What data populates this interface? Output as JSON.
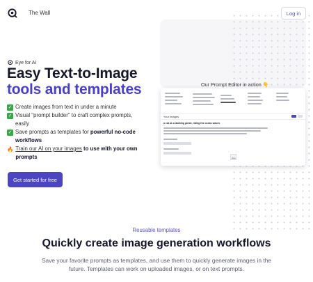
{
  "header": {
    "brand": "The Wall",
    "login_label": "Log in",
    "logo_icon": "eye-logo-icon"
  },
  "hero": {
    "eyebrow": "Eye for AI",
    "title_line1": "Easy Text-to-Image",
    "title_line2": "tools and templates",
    "features": [
      {
        "text": "Create images from text in under a minute"
      },
      {
        "text": "Visual \"prompt builder\" to craft complex prompts, easily"
      },
      {
        "text_before": "Save prompts as templates for ",
        "bold": "powerful no-code workflows"
      },
      {
        "link": "Train our AI on your images",
        "bold": " to use with your own prompts"
      }
    ],
    "cta_label": "Get started for free"
  },
  "preview": {
    "label": "Our Prompt Editor in action 👇",
    "panel_title": "Your images",
    "prompt": "a cat as a dashing pirate, riding the ocean waves"
  },
  "section": {
    "kicker": "Reusable templates",
    "title": "Quickly create image generation workflows",
    "description": "Save your favorite prompts as templates, and use them to quickly generate images in the future. Templates can work on uploaded images, or on text prompts."
  },
  "colors": {
    "accent": "#4a40c8",
    "button": "#4b45c4",
    "check": "#3fa34d"
  }
}
